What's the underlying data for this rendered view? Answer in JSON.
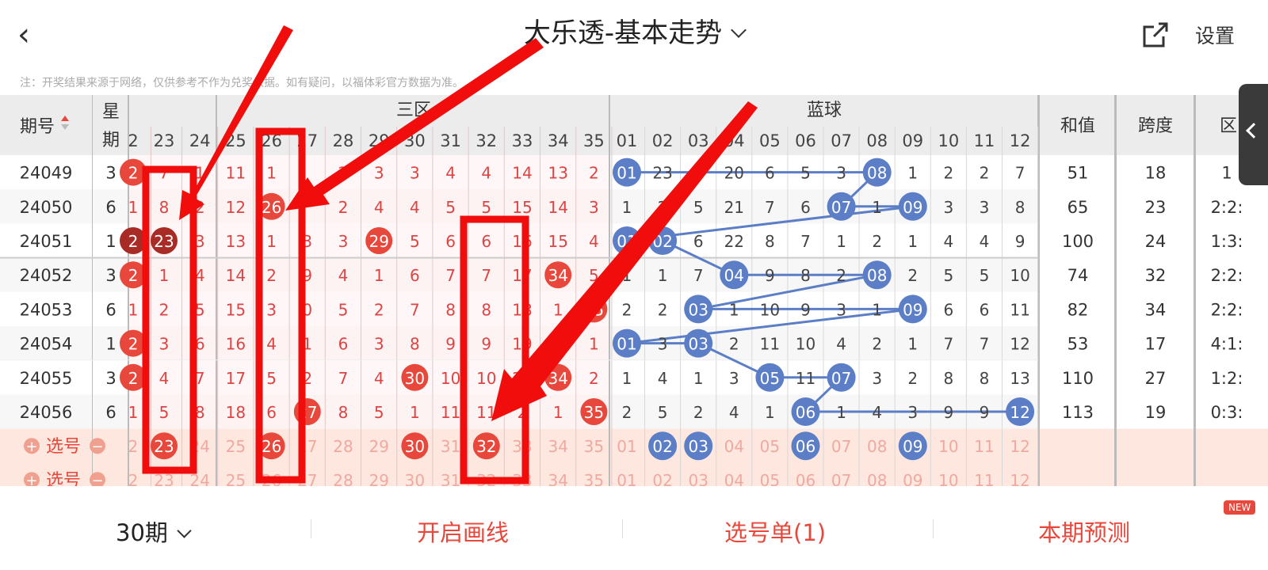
{
  "header": {
    "back_icon": "chevron-left-icon",
    "title": "大乐透-基本走势",
    "share_icon": "external-link-icon",
    "settings_label": "设置"
  },
  "note": "注：开奖结果来源于网络，仅供参考不作为兑奖依据。如有疑问，以福体彩官方数据为准。",
  "table": {
    "headers": {
      "issue": "期号",
      "weekday_top": "星",
      "weekday_bottom": "期",
      "zone3": "三区",
      "blue": "蓝球",
      "sum": "和值",
      "span": "跨度",
      "ratio": "区"
    },
    "red_cols": [
      "2",
      "23",
      "24",
      "25",
      "26",
      "27",
      "28",
      "29",
      "30",
      "31",
      "32",
      "33",
      "34",
      "35"
    ],
    "blue_cols": [
      "01",
      "02",
      "03",
      "04",
      "05",
      "06",
      "07",
      "08",
      "09",
      "10",
      "11",
      "12"
    ],
    "rows": [
      {
        "issue": "24049",
        "week": "3",
        "red": [
          "2",
          "7",
          "1",
          "11",
          "1",
          "",
          "2",
          "3",
          "3",
          "4",
          "4",
          "14",
          "13",
          "2"
        ],
        "red_hits": [
          0
        ],
        "blue": [
          "01",
          "23",
          "4",
          "20",
          "6",
          "5",
          "3",
          "08",
          "1",
          "2",
          "2",
          "7"
        ],
        "blue_hits": [
          0,
          7
        ],
        "sum": "51",
        "span": "18",
        "ratio": "1"
      },
      {
        "issue": "24050",
        "week": "6",
        "red": [
          "1",
          "8",
          "2",
          "12",
          "26",
          "",
          "2",
          "4",
          "4",
          "5",
          "5",
          "15",
          "14",
          "3"
        ],
        "red_hits": [
          4
        ],
        "blue": [
          "1",
          "2",
          "5",
          "21",
          "7",
          "6",
          "07",
          "1",
          "09",
          "3",
          "3",
          "8"
        ],
        "blue_hits": [
          6,
          8
        ],
        "sum": "65",
        "span": "23",
        "ratio": "2:2:"
      },
      {
        "issue": "24051",
        "week": "1",
        "red": [
          "2",
          "23",
          "3",
          "13",
          "1",
          "3",
          "3",
          "29",
          "5",
          "6",
          "6",
          "16",
          "15",
          "4"
        ],
        "red_hits": [
          0,
          1,
          7
        ],
        "blue": [
          "01",
          "02",
          "6",
          "22",
          "8",
          "7",
          "1",
          "2",
          "1",
          "4",
          "4",
          "9"
        ],
        "blue_hits": [
          0,
          1
        ],
        "sum": "100",
        "span": "24",
        "ratio": "1:3:"
      },
      {
        "issue": "24052",
        "week": "3",
        "red": [
          "2",
          "1",
          "4",
          "14",
          "2",
          "9",
          "4",
          "1",
          "6",
          "7",
          "7",
          "17",
          "34",
          "5"
        ],
        "red_hits": [
          0,
          12
        ],
        "blue": [
          "1",
          "1",
          "7",
          "04",
          "9",
          "8",
          "2",
          "08",
          "2",
          "5",
          "5",
          "10"
        ],
        "blue_hits": [
          3,
          7
        ],
        "sum": "74",
        "span": "32",
        "ratio": "2:2:"
      },
      {
        "issue": "24053",
        "week": "6",
        "red": [
          "1",
          "2",
          "5",
          "15",
          "3",
          "0",
          "5",
          "2",
          "7",
          "8",
          "8",
          "18",
          "1",
          "35"
        ],
        "red_hits": [
          13
        ],
        "blue": [
          "2",
          "2",
          "03",
          "1",
          "10",
          "9",
          "3",
          "1",
          "09",
          "6",
          "6",
          "11"
        ],
        "blue_hits": [
          2,
          8
        ],
        "sum": "82",
        "span": "34",
        "ratio": "2:2:"
      },
      {
        "issue": "24054",
        "week": "1",
        "red": [
          "2",
          "3",
          "6",
          "16",
          "4",
          "1",
          "6",
          "3",
          "8",
          "9",
          "9",
          "19",
          "2",
          "1"
        ],
        "red_hits": [
          0
        ],
        "blue": [
          "01",
          "3",
          "03",
          "2",
          "11",
          "10",
          "4",
          "2",
          "1",
          "7",
          "7",
          "12"
        ],
        "blue_hits": [
          0,
          2
        ],
        "sum": "53",
        "span": "17",
        "ratio": "4:1:"
      },
      {
        "issue": "24055",
        "week": "3",
        "red": [
          "2",
          "4",
          "7",
          "17",
          "5",
          "2",
          "7",
          "4",
          "30",
          "10",
          "10",
          "20",
          "34",
          "2"
        ],
        "red_hits": [
          0,
          8,
          12
        ],
        "blue": [
          "1",
          "4",
          "1",
          "3",
          "05",
          "11",
          "07",
          "3",
          "2",
          "8",
          "8",
          "13"
        ],
        "blue_hits": [
          4,
          6
        ],
        "sum": "110",
        "span": "27",
        "ratio": "1:2:"
      },
      {
        "issue": "24056",
        "week": "6",
        "red": [
          "1",
          "5",
          "8",
          "18",
          "6",
          "27",
          "8",
          "5",
          "1",
          "11",
          "11",
          "2",
          "1",
          "35"
        ],
        "red_hits": [
          5,
          13
        ],
        "blue": [
          "2",
          "5",
          "2",
          "4",
          "1",
          "06",
          "1",
          "4",
          "3",
          "9",
          "9",
          "12"
        ],
        "blue_hits": [
          5,
          11
        ],
        "sum": "113",
        "span": "19",
        "ratio": "0:3:"
      }
    ],
    "select_label": "选号",
    "select_red_hits": [
      1,
      4,
      8,
      10
    ],
    "select_blue_hits": [
      1,
      2,
      5,
      8
    ]
  },
  "bottom": {
    "periods": "30期",
    "draw_line": "开启画线",
    "selection": "选号单(1)",
    "predict": "本期预测",
    "badge": "NEW"
  },
  "colors": {
    "red": "#e8473b",
    "dark_red": "#a82c25",
    "blue": "#5b7ec6",
    "annotation": "#f20d0d"
  }
}
